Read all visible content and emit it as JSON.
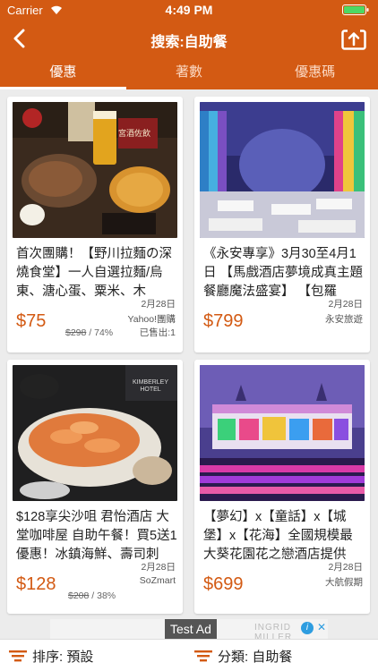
{
  "status": {
    "carrier": "Carrier",
    "time": "4:49 PM"
  },
  "nav": {
    "title": "搜索:自助餐"
  },
  "tabs": [
    {
      "label": "優惠",
      "active": true
    },
    {
      "label": "著數",
      "active": false
    },
    {
      "label": "優惠碼",
      "active": false
    }
  ],
  "deals": [
    {
      "title": "首次團購！【野川拉麵の深燒食堂】一人自選拉麵/烏東、溏心蛋、粟米、木",
      "date": "2月28日",
      "price": "$75",
      "original_price": "$298",
      "discount": "/ 74%",
      "vendor": "Yahoo!團購",
      "sold": "已售出:1",
      "image_text": "宮酒佐飲"
    },
    {
      "title": "《永安專享》3月30至4月1日 【馬戲酒店夢境成真主題餐廳魔法盛宴】 【包羅",
      "date": "2月28日",
      "price": "$799",
      "vendor": "永安旅遊"
    },
    {
      "title": "$128享尖沙咀 君怡酒店 大堂咖啡屋 自助午餐！買5送1優惠！冰鎮海鮮、壽司刺",
      "date": "2月28日",
      "price": "$128",
      "original_price": "$208",
      "discount": "/ 38%",
      "vendor": "SoZmart",
      "image_text": "KIMBERLEY HOTEL"
    },
    {
      "title": "【夢幻】x【童話】x【城堡】x【花海】全國規模最大葵花園花之戀酒店提供",
      "date": "2月28日",
      "price": "$699",
      "vendor": "大航假期"
    }
  ],
  "ad": {
    "label": "Test Ad",
    "faint_text": "INGRID MILLER"
  },
  "bottom": {
    "sort_label": "排序: 預設",
    "category_label": "分類: 自助餐"
  },
  "colors": {
    "brand": "#d35a13",
    "price": "#d35a13",
    "background": "#ececec"
  }
}
